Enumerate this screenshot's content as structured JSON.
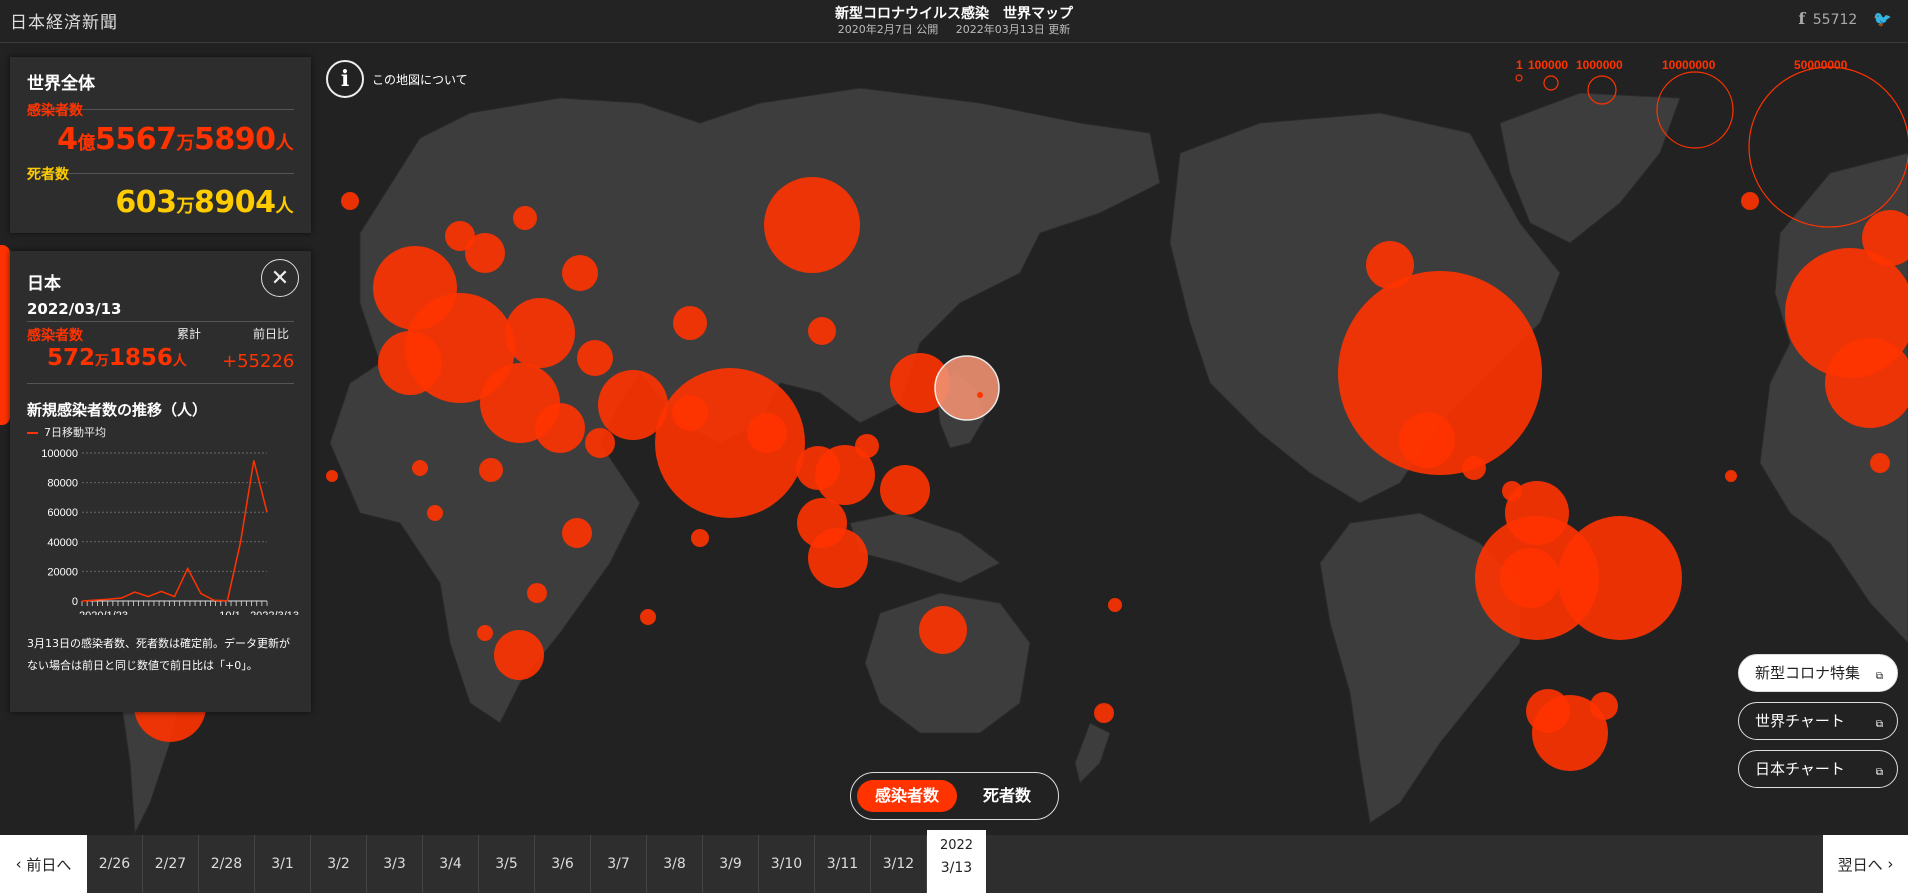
{
  "header": {
    "logo": "日本経済新聞",
    "title": "新型コロナウイルス感染　世界マップ",
    "published": "2020年2月7日 公開",
    "updated": "2022年03月13日 更新",
    "facebook_icon": "f",
    "facebook_count": "55712",
    "twitter_icon": "🐦"
  },
  "map_info": {
    "icon": "i",
    "label": "この地図について"
  },
  "legend": {
    "labels": [
      "1",
      "100000",
      "1000000",
      "10000000",
      "50000000"
    ]
  },
  "global": {
    "title": "世界全体",
    "cases_label": "感染者数",
    "cases": {
      "a": "4",
      "au": "億",
      "b": "5567",
      "bu": "万",
      "c": "5890",
      "cu": "人"
    },
    "deaths_label": "死者数",
    "deaths": {
      "b": "603",
      "bu": "万",
      "c": "8904",
      "cu": "人"
    }
  },
  "country": {
    "name": "日本",
    "close_icon": "✕",
    "date": "2022/03/13",
    "cases_label": "感染者数",
    "cumulative_label": "累計",
    "day_change_label": "前日比",
    "cumulative": {
      "b": "572",
      "bu": "万",
      "c": "1856",
      "cu": "人"
    },
    "day_change": "+55226",
    "trend_title": "新規感染者数の推移（人）",
    "ma_label": "7日移動平均",
    "note": "3月13日の感染者数、死者数は確定前。データ更新がない場合は前日と同じ数値で前日比は「+0」。"
  },
  "chart_data": {
    "type": "line",
    "series": [
      {
        "name": "7日移動平均"
      }
    ],
    "x": [
      "2020/1/23",
      "2020/4",
      "2020/8",
      "2020/12",
      "2021/1",
      "2021/4",
      "2021/5",
      "2021/7",
      "2021/8",
      "2021/9",
      "2021/10/1",
      "2021/12",
      "2022/1",
      "2022/2",
      "2022/3/13"
    ],
    "values": [
      0,
      600,
      1200,
      2000,
      6000,
      3000,
      6500,
      3000,
      22000,
      5000,
      500,
      200,
      40000,
      95000,
      60000
    ],
    "ylim": [
      0,
      100000
    ],
    "yticks": [
      "100000",
      "80000",
      "60000",
      "40000",
      "20000",
      "0"
    ],
    "xtick_labels": [
      "2020/1/23",
      "10/1",
      "2022/3/13"
    ],
    "grid": true
  },
  "toggle": {
    "option_a": "感染者数",
    "option_b": "死者数"
  },
  "side_buttons": [
    {
      "label": "新型コロナ特集",
      "icon": "⧉"
    },
    {
      "label": "世界チャート",
      "icon": "⧉"
    },
    {
      "label": "日本チャート",
      "icon": "⧉"
    }
  ],
  "timeline": {
    "prev_label": "前日へ",
    "next_label": "翌日へ",
    "dates": [
      "2/26",
      "2/27",
      "2/28",
      "3/1",
      "3/2",
      "3/3",
      "3/4",
      "3/5",
      "3/6",
      "3/7",
      "3/8",
      "3/9",
      "3/10",
      "3/11",
      "3/12"
    ],
    "current_year": "2022",
    "current_date": "3/13"
  },
  "colors": {
    "accent": "#ff3300",
    "deaths": "#ffcc00",
    "land": "#3d3d3d",
    "sea": "#222222",
    "japan": "#f09070"
  }
}
